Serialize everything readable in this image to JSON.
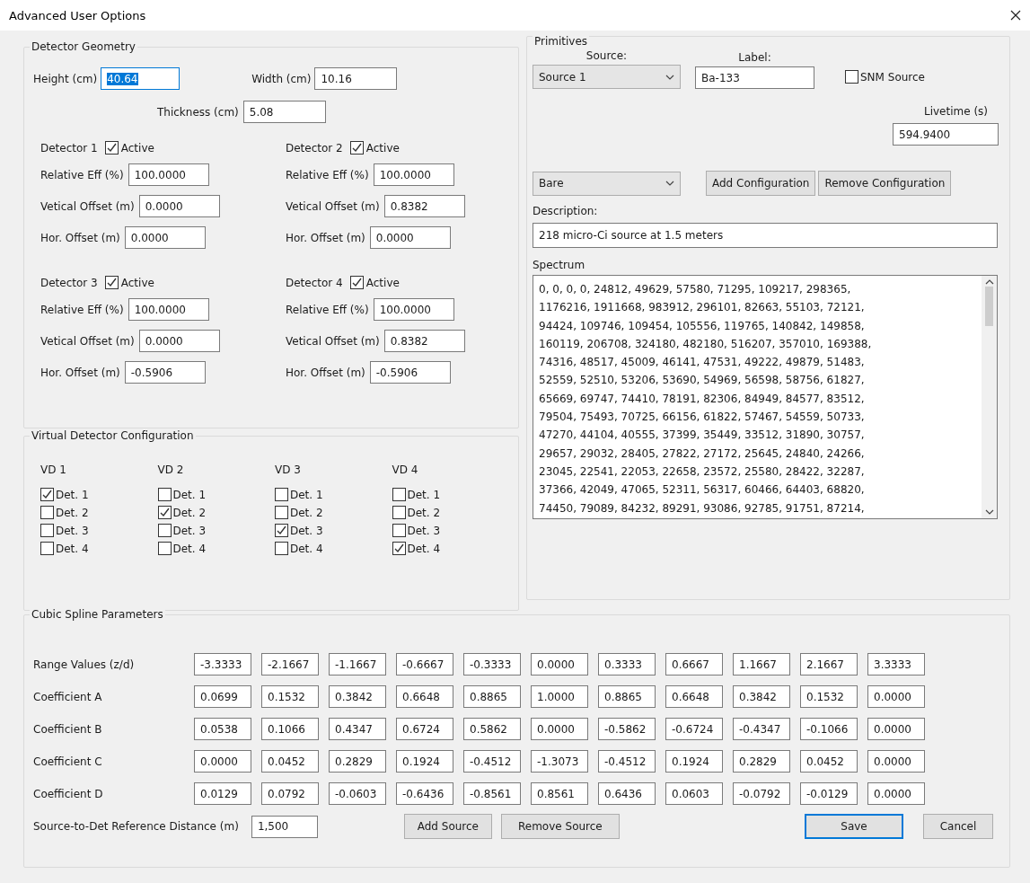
{
  "window": {
    "title": "Advanced User Options"
  },
  "detector_geometry": {
    "title": "Detector Geometry",
    "height": {
      "label": "Height (cm)",
      "value": "40.64",
      "text_selected": true
    },
    "width": {
      "label": "Width (cm)",
      "value": "10.16",
      "text_selected": false
    },
    "thickness": {
      "label": "Thickness (cm)",
      "value": "5.08",
      "text_selected": false
    },
    "detectors": [
      {
        "name": "Detector 1",
        "active_label": "Active",
        "active": true,
        "fields": [
          {
            "label": "Relative Eff (%)",
            "value": "100.0000"
          },
          {
            "label": "Vetical Offset (m)",
            "value": "0.0000"
          },
          {
            "label": "Hor. Offset (m)",
            "value": "0.0000"
          }
        ]
      },
      {
        "name": "Detector 2",
        "active_label": "Active",
        "active": true,
        "fields": [
          {
            "label": "Relative Eff (%)",
            "value": "100.0000"
          },
          {
            "label": "Vetical Offset (m)",
            "value": "0.8382"
          },
          {
            "label": "Hor. Offset (m)",
            "value": "0.0000"
          }
        ]
      },
      {
        "name": "Detector 3",
        "active_label": "Active",
        "active": true,
        "fields": [
          {
            "label": "Relative Eff (%)",
            "value": "100.0000"
          },
          {
            "label": "Vetical Offset (m)",
            "value": "0.0000"
          },
          {
            "label": "Hor. Offset (m)",
            "value": "-0.5906"
          }
        ]
      },
      {
        "name": "Detector 4",
        "active_label": "Active",
        "active": true,
        "fields": [
          {
            "label": "Relative Eff (%)",
            "value": "100.0000"
          },
          {
            "label": "Vetical Offset (m)",
            "value": "0.8382"
          },
          {
            "label": "Hor. Offset (m)",
            "value": "-0.5906"
          }
        ]
      }
    ]
  },
  "virtual_detector_configuration": {
    "title": "Virtual Detector Configuration",
    "columns": [
      {
        "name": "VD 1",
        "options": [
          {
            "label": "Det. 1",
            "checked": true
          },
          {
            "label": "Det. 2",
            "checked": false
          },
          {
            "label": "Det. 3",
            "checked": false
          },
          {
            "label": "Det. 4",
            "checked": false
          }
        ]
      },
      {
        "name": "VD 2",
        "options": [
          {
            "label": "Det. 1",
            "checked": false
          },
          {
            "label": "Det. 2",
            "checked": true
          },
          {
            "label": "Det. 3",
            "checked": false
          },
          {
            "label": "Det. 4",
            "checked": false
          }
        ]
      },
      {
        "name": "VD 3",
        "options": [
          {
            "label": "Det. 1",
            "checked": false
          },
          {
            "label": "Det. 2",
            "checked": false
          },
          {
            "label": "Det. 3",
            "checked": true
          },
          {
            "label": "Det. 4",
            "checked": false
          }
        ]
      },
      {
        "name": "VD 4",
        "options": [
          {
            "label": "Det. 1",
            "checked": false
          },
          {
            "label": "Det. 2",
            "checked": false
          },
          {
            "label": "Det. 3",
            "checked": false
          },
          {
            "label": "Det. 4",
            "checked": true
          }
        ]
      }
    ]
  },
  "primitives": {
    "title": "Primitives",
    "source": {
      "label": "Source:",
      "value": "Source 1"
    },
    "label": {
      "label": "Label:",
      "value": "Ba-133"
    },
    "snm_source": {
      "label": "SNM Source",
      "checked": false
    },
    "livetime": {
      "label": "Livetime (s)",
      "value": "594.9400"
    },
    "configuration": {
      "value": "Bare"
    },
    "buttons": [
      {
        "label": "Add Configuration"
      },
      {
        "label": "Remove Configuration"
      }
    ],
    "description": {
      "label": "Description:",
      "value": "218 micro-Ci source at 1.5 meters"
    },
    "spectrum": {
      "label": "Spectrum",
      "lines": [
        "0, 0, 0, 0, 24812, 49629, 57580, 71295, 109217, 298365,",
        "1176216, 1911668, 983912, 296101, 82663, 55103, 72121,",
        "94424, 109746, 109454, 105556, 119765, 140842, 149858,",
        "160119, 206708, 324180, 482180, 516207, 357010, 169388,",
        "74316, 48517, 45009, 46141, 47531, 49222, 49879, 51483,",
        "52559, 52510, 53206, 53690, 54969, 56598, 58756, 61827,",
        "65669, 69747, 74410, 78191, 82306, 84949, 84577, 83512,",
        "79504, 75493, 70725, 66156, 61822, 57467, 54559, 50733,",
        "47270, 44104, 40555, 37399, 35449, 33512, 31890, 30757,",
        "29657, 29032, 28405, 27822, 27172, 25645, 24840, 24266,",
        "23045, 22541, 22053, 22658, 23572, 25580, 28422, 32287,",
        "37366, 42049, 47065, 52311, 56317, 60466, 64403, 68820,",
        "74450, 79089, 84232, 89291, 93086, 92785, 91751, 87214,"
      ]
    }
  },
  "cubic_spline_parameters": {
    "title": "Cubic Spline Parameters",
    "rows": [
      {
        "label": "Range Values (z/d)",
        "values": [
          "-3.3333",
          "-2.1667",
          "-1.1667",
          "-0.6667",
          "-0.3333",
          "0.0000",
          "0.3333",
          "0.6667",
          "1.1667",
          "2.1667",
          "3.3333"
        ]
      },
      {
        "label": "Coefficient A",
        "values": [
          "0.0699",
          "0.1532",
          "0.3842",
          "0.6648",
          "0.8865",
          "1.0000",
          "0.8865",
          "0.6648",
          "0.3842",
          "0.1532",
          "0.0000"
        ]
      },
      {
        "label": "Coefficient B",
        "values": [
          "0.0538",
          "0.1066",
          "0.4347",
          "0.6724",
          "0.5862",
          "0.0000",
          "-0.5862",
          "-0.6724",
          "-0.4347",
          "-0.1066",
          "0.0000"
        ]
      },
      {
        "label": "Coefficient C",
        "values": [
          "0.0000",
          "0.0452",
          "0.2829",
          "0.1924",
          "-0.4512",
          "-1.3073",
          "-0.4512",
          "0.1924",
          "0.2829",
          "0.0452",
          "0.0000"
        ]
      },
      {
        "label": "Coefficient D",
        "values": [
          "0.0129",
          "0.0792",
          "-0.0603",
          "-0.6436",
          "-0.8561",
          "0.8561",
          "0.6436",
          "0.0603",
          "-0.0792",
          "-0.0129",
          "0.0000"
        ]
      }
    ],
    "reference_distance": {
      "label": "Source-to-Det Reference Distance (m)",
      "value": "1,500"
    },
    "buttons": [
      {
        "label": "Add Source",
        "default": false
      },
      {
        "label": "Remove Source",
        "default": false
      },
      {
        "label": "Save",
        "default": true
      },
      {
        "label": "Cancel",
        "default": false
      }
    ]
  }
}
